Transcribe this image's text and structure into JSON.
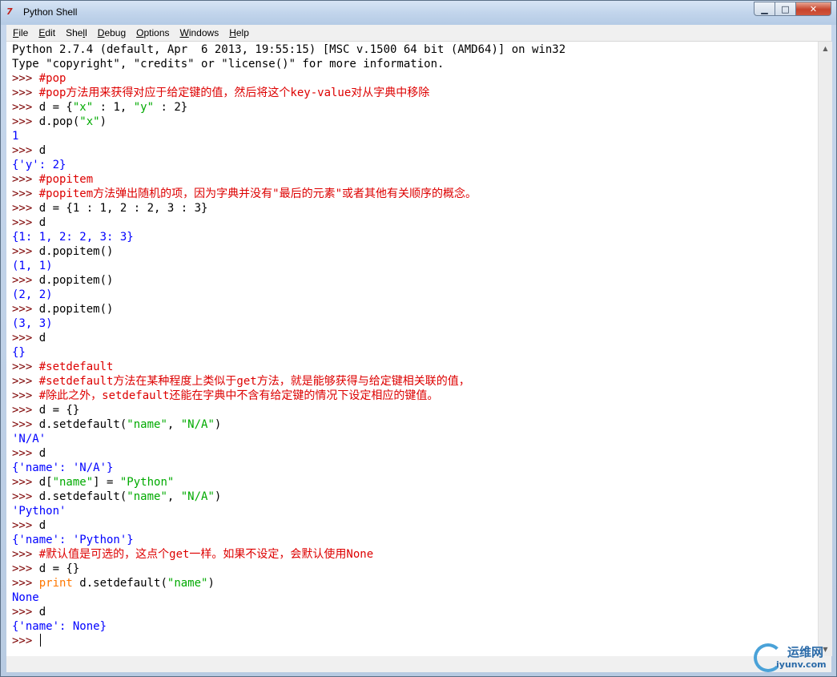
{
  "window": {
    "title": "Python Shell",
    "icon": "python-idle-icon",
    "icon_glyph": "7",
    "controls": {
      "min": "▁",
      "max": "□",
      "close": "✕"
    }
  },
  "menu": [
    {
      "pre": "",
      "ul": "F",
      "post": "ile"
    },
    {
      "pre": "",
      "ul": "E",
      "post": "dit"
    },
    {
      "pre": "She",
      "ul": "l",
      "post": "l"
    },
    {
      "pre": "",
      "ul": "D",
      "post": "ebug"
    },
    {
      "pre": "",
      "ul": "O",
      "post": "ptions"
    },
    {
      "pre": "",
      "ul": "W",
      "post": "indows"
    },
    {
      "pre": "",
      "ul": "H",
      "post": "elp"
    }
  ],
  "colors": {
    "prompt": "#7d0000",
    "comment": "#dd0000",
    "string": "#00aa00",
    "output": "#0000ff",
    "keyword": "#ff7700"
  },
  "shell_lines": [
    [
      [
        "",
        "Python 2.7.4 (default, Apr  6 2013, 19:55:15) [MSC v.1500 64 bit (AMD64)] on win32"
      ]
    ],
    [
      [
        "",
        "Type \"copyright\", \"credits\" or \"license()\" for more information."
      ]
    ],
    [
      [
        "p",
        ">>> "
      ],
      [
        "c",
        "#pop"
      ]
    ],
    [
      [
        "p",
        ">>> "
      ],
      [
        "c",
        "#pop方法用来获得对应于给定键的值，然后将这个key-value对从字典中移除"
      ]
    ],
    [
      [
        "p",
        ">>> "
      ],
      [
        "",
        "d = {"
      ],
      [
        "s",
        "\"x\""
      ],
      [
        "",
        " : 1, "
      ],
      [
        "s",
        "\"y\""
      ],
      [
        "",
        " : 2}"
      ]
    ],
    [
      [
        "p",
        ">>> "
      ],
      [
        "",
        "d.pop("
      ],
      [
        "s",
        "\"x\""
      ],
      [
        "",
        ")"
      ]
    ],
    [
      [
        "o",
        "1"
      ]
    ],
    [
      [
        "p",
        ">>> "
      ],
      [
        "",
        "d"
      ]
    ],
    [
      [
        "o",
        "{'y': 2}"
      ]
    ],
    [
      [
        "p",
        ">>> "
      ],
      [
        "c",
        "#popitem"
      ]
    ],
    [
      [
        "p",
        ">>> "
      ],
      [
        "c",
        "#popitem方法弹出随机的项，因为字典并没有\"最后的元素\"或者其他有关顺序的概念。"
      ]
    ],
    [
      [
        "p",
        ">>> "
      ],
      [
        "",
        "d = {1 : 1, 2 : 2, 3 : 3}"
      ]
    ],
    [
      [
        "p",
        ">>> "
      ],
      [
        "",
        "d"
      ]
    ],
    [
      [
        "o",
        "{1: 1, 2: 2, 3: 3}"
      ]
    ],
    [
      [
        "p",
        ">>> "
      ],
      [
        "",
        "d.popitem()"
      ]
    ],
    [
      [
        "o",
        "(1, 1)"
      ]
    ],
    [
      [
        "p",
        ">>> "
      ],
      [
        "",
        "d.popitem()"
      ]
    ],
    [
      [
        "o",
        "(2, 2)"
      ]
    ],
    [
      [
        "p",
        ">>> "
      ],
      [
        "",
        "d.popitem()"
      ]
    ],
    [
      [
        "o",
        "(3, 3)"
      ]
    ],
    [
      [
        "p",
        ">>> "
      ],
      [
        "",
        "d"
      ]
    ],
    [
      [
        "o",
        "{}"
      ]
    ],
    [
      [
        "p",
        ">>> "
      ],
      [
        "c",
        "#setdefault"
      ]
    ],
    [
      [
        "p",
        ">>> "
      ],
      [
        "c",
        "#setdefault方法在某种程度上类似于get方法，就是能够获得与给定键相关联的值，"
      ]
    ],
    [
      [
        "p",
        ">>> "
      ],
      [
        "c",
        "#除此之外，setdefault还能在字典中不含有给定键的情况下设定相应的键值。"
      ]
    ],
    [
      [
        "p",
        ">>> "
      ],
      [
        "",
        "d = {}"
      ]
    ],
    [
      [
        "p",
        ">>> "
      ],
      [
        "",
        "d.setdefault("
      ],
      [
        "s",
        "\"name\""
      ],
      [
        "",
        ", "
      ],
      [
        "s",
        "\"N/A\""
      ],
      [
        "",
        ")"
      ]
    ],
    [
      [
        "o",
        "'N/A'"
      ]
    ],
    [
      [
        "p",
        ">>> "
      ],
      [
        "",
        "d"
      ]
    ],
    [
      [
        "o",
        "{'name': 'N/A'}"
      ]
    ],
    [
      [
        "p",
        ">>> "
      ],
      [
        "",
        "d["
      ],
      [
        "s",
        "\"name\""
      ],
      [
        "",
        "] = "
      ],
      [
        "s",
        "\"Python\""
      ]
    ],
    [
      [
        "p",
        ">>> "
      ],
      [
        "",
        "d.setdefault("
      ],
      [
        "s",
        "\"name\""
      ],
      [
        "",
        ", "
      ],
      [
        "s",
        "\"N/A\""
      ],
      [
        "",
        ")"
      ]
    ],
    [
      [
        "o",
        "'Python'"
      ]
    ],
    [
      [
        "p",
        ">>> "
      ],
      [
        "",
        "d"
      ]
    ],
    [
      [
        "o",
        "{'name': 'Python'}"
      ]
    ],
    [
      [
        "p",
        ">>> "
      ],
      [
        "c",
        "#默认值是可选的，这点个get一样。如果不设定，会默认使用None"
      ]
    ],
    [
      [
        "p",
        ">>> "
      ],
      [
        "",
        "d = {}"
      ]
    ],
    [
      [
        "p",
        ">>> "
      ],
      [
        "k",
        "print"
      ],
      [
        "",
        " d.setdefault("
      ],
      [
        "s",
        "\"name\""
      ],
      [
        "",
        ")"
      ]
    ],
    [
      [
        "o",
        "None"
      ]
    ],
    [
      [
        "p",
        ">>> "
      ],
      [
        "",
        "d"
      ]
    ],
    [
      [
        "o",
        "{'name': None}"
      ]
    ],
    [
      [
        "p",
        ">>> "
      ]
    ]
  ],
  "scrollbar": {
    "up": "▲",
    "down": "▼"
  },
  "watermark": {
    "title": "运维网",
    "subtitle": "iyunv.com"
  }
}
